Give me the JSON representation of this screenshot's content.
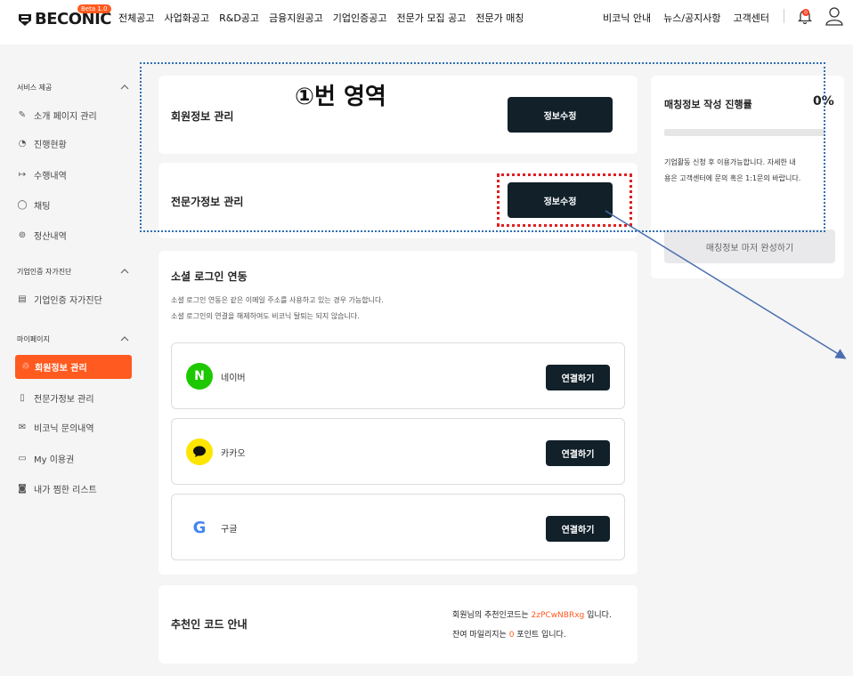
{
  "header": {
    "logo_text": "BECONIC",
    "beta_badge": "Beta 1.0",
    "nav": [
      "전체공고",
      "사업화공고",
      "R&D공고",
      "금융지원공고",
      "기업인증공고",
      "전문가 모집 공고",
      "전문가 매칭"
    ],
    "util": [
      "비코닉 안내",
      "뉴스/공지사항",
      "고객센터"
    ],
    "notification_count": "0"
  },
  "sidebar": {
    "sections": [
      {
        "title": "서비스 제공",
        "items": [
          "소개 페이지 관리",
          "진행현황",
          "수행내역",
          "채팅",
          "정산내역"
        ]
      },
      {
        "title": "기업인증 자가진단",
        "items": [
          "기업인증 자가진단"
        ]
      },
      {
        "title": "마이페이지",
        "items": [
          "회원정보 관리",
          "전문가정보 관리",
          "비코닉 문의내역",
          "My 이용권",
          "내가 찜한 리스트"
        ]
      }
    ]
  },
  "annotation": {
    "label": "①번 영역"
  },
  "member_info": {
    "title": "회원정보 관리",
    "button": "정보수정"
  },
  "expert_info": {
    "title": "전문가정보 관리",
    "button": "정보수정"
  },
  "social": {
    "title": "소셜 로그인 연동",
    "desc1": "소셜 로그인 연동은 같은 이메일 주소를 사용하고 있는 경우 가능합니다.",
    "desc2": "소셜 로그인의 연결을 해제하여도 비코닉 탈퇴는 되지 않습니다.",
    "providers": [
      {
        "label": "네이버",
        "icon": "N",
        "button": "연결하기",
        "color": "#1ec800"
      },
      {
        "label": "카카오",
        "icon": "kakao-icon",
        "button": "연결하기",
        "color": "#fee500"
      },
      {
        "label": "구글",
        "icon": "G",
        "button": "연결하기",
        "color": "#4285f4"
      }
    ]
  },
  "referral": {
    "title": "추천인 코드 안내",
    "line1_prefix": "회원님의 추천인코드는 ",
    "code": "2zPCwNBRxg",
    "line1_suffix": " 입니다.",
    "line2_prefix": "잔여 마일리지는 ",
    "mileage": "0",
    "line2_suffix": " 포인트 입니다."
  },
  "matching": {
    "title": "매칭정보 작성 진행률",
    "percent": "0%",
    "progress": 0,
    "notice1": "기업활동 신청 후 이용가능합니다. 자세한 내",
    "notice2": "용은 고객센터에 문의 혹은 1:1문의 바랍니다.",
    "button": "매칭정보 마저 완성하기"
  },
  "colors": {
    "accent": "#ff5a1f",
    "dark_button": "#112029",
    "annotation_blue": "#2c6fb5",
    "annotation_red": "#e02020"
  }
}
